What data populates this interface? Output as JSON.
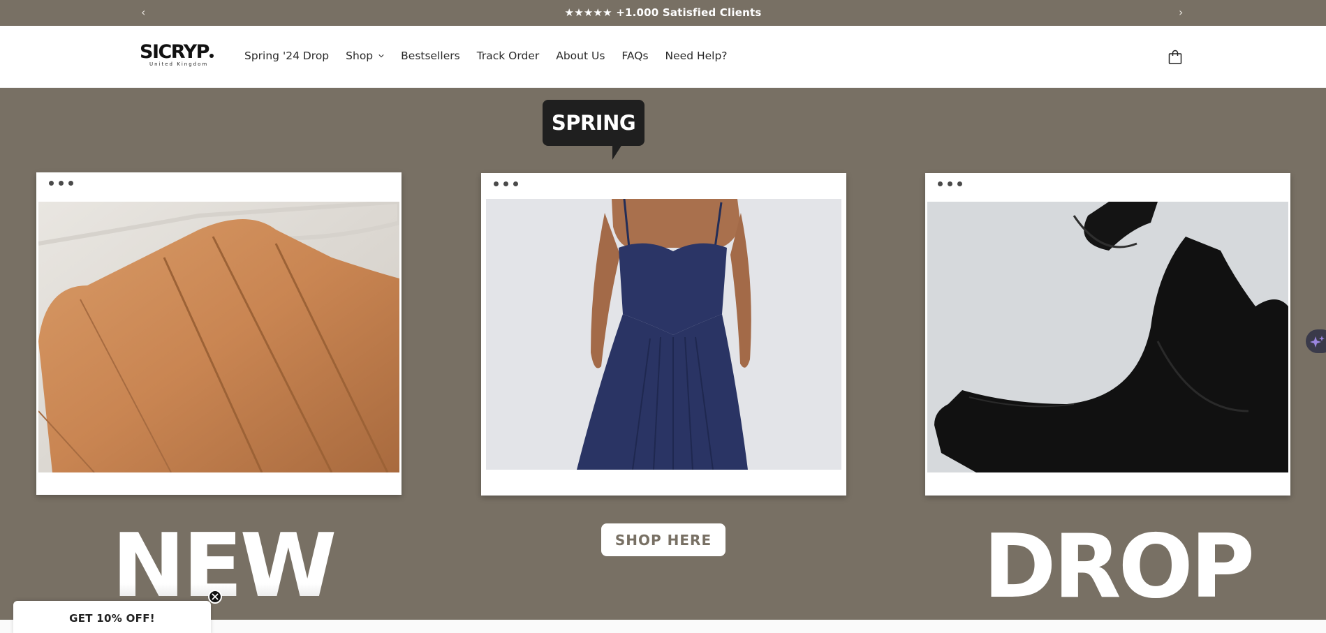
{
  "announcement": {
    "message": "★★★★★ +1.000 Satisfied Clients",
    "prev_icon": "chevron-left-icon",
    "next_icon": "chevron-right-icon"
  },
  "header": {
    "logo_text": "SICRYP",
    "logo_subtitle": "United Kingdom",
    "nav": [
      {
        "label": "Spring '24 Drop"
      },
      {
        "label": "Shop",
        "has_dropdown": true
      },
      {
        "label": "Bestsellers"
      },
      {
        "label": "Track Order"
      },
      {
        "label": "About Us"
      },
      {
        "label": "FAQs"
      },
      {
        "label": "Need Help?"
      }
    ],
    "cart_icon": "shopping-bag-icon"
  },
  "hero": {
    "badge": "SPRING",
    "cta": "SHOP HERE",
    "word_left": "NEW",
    "word_right": "DROP",
    "cards": [
      {
        "name": "tan-corset-photo"
      },
      {
        "name": "navy-dress-photo"
      },
      {
        "name": "black-bodysuit-photo"
      }
    ]
  },
  "popup": {
    "label": "GET 10% OFF!"
  },
  "colors": {
    "brand_taupe": "#787064",
    "dark_badge": "#1f1f1f",
    "white": "#ffffff"
  }
}
